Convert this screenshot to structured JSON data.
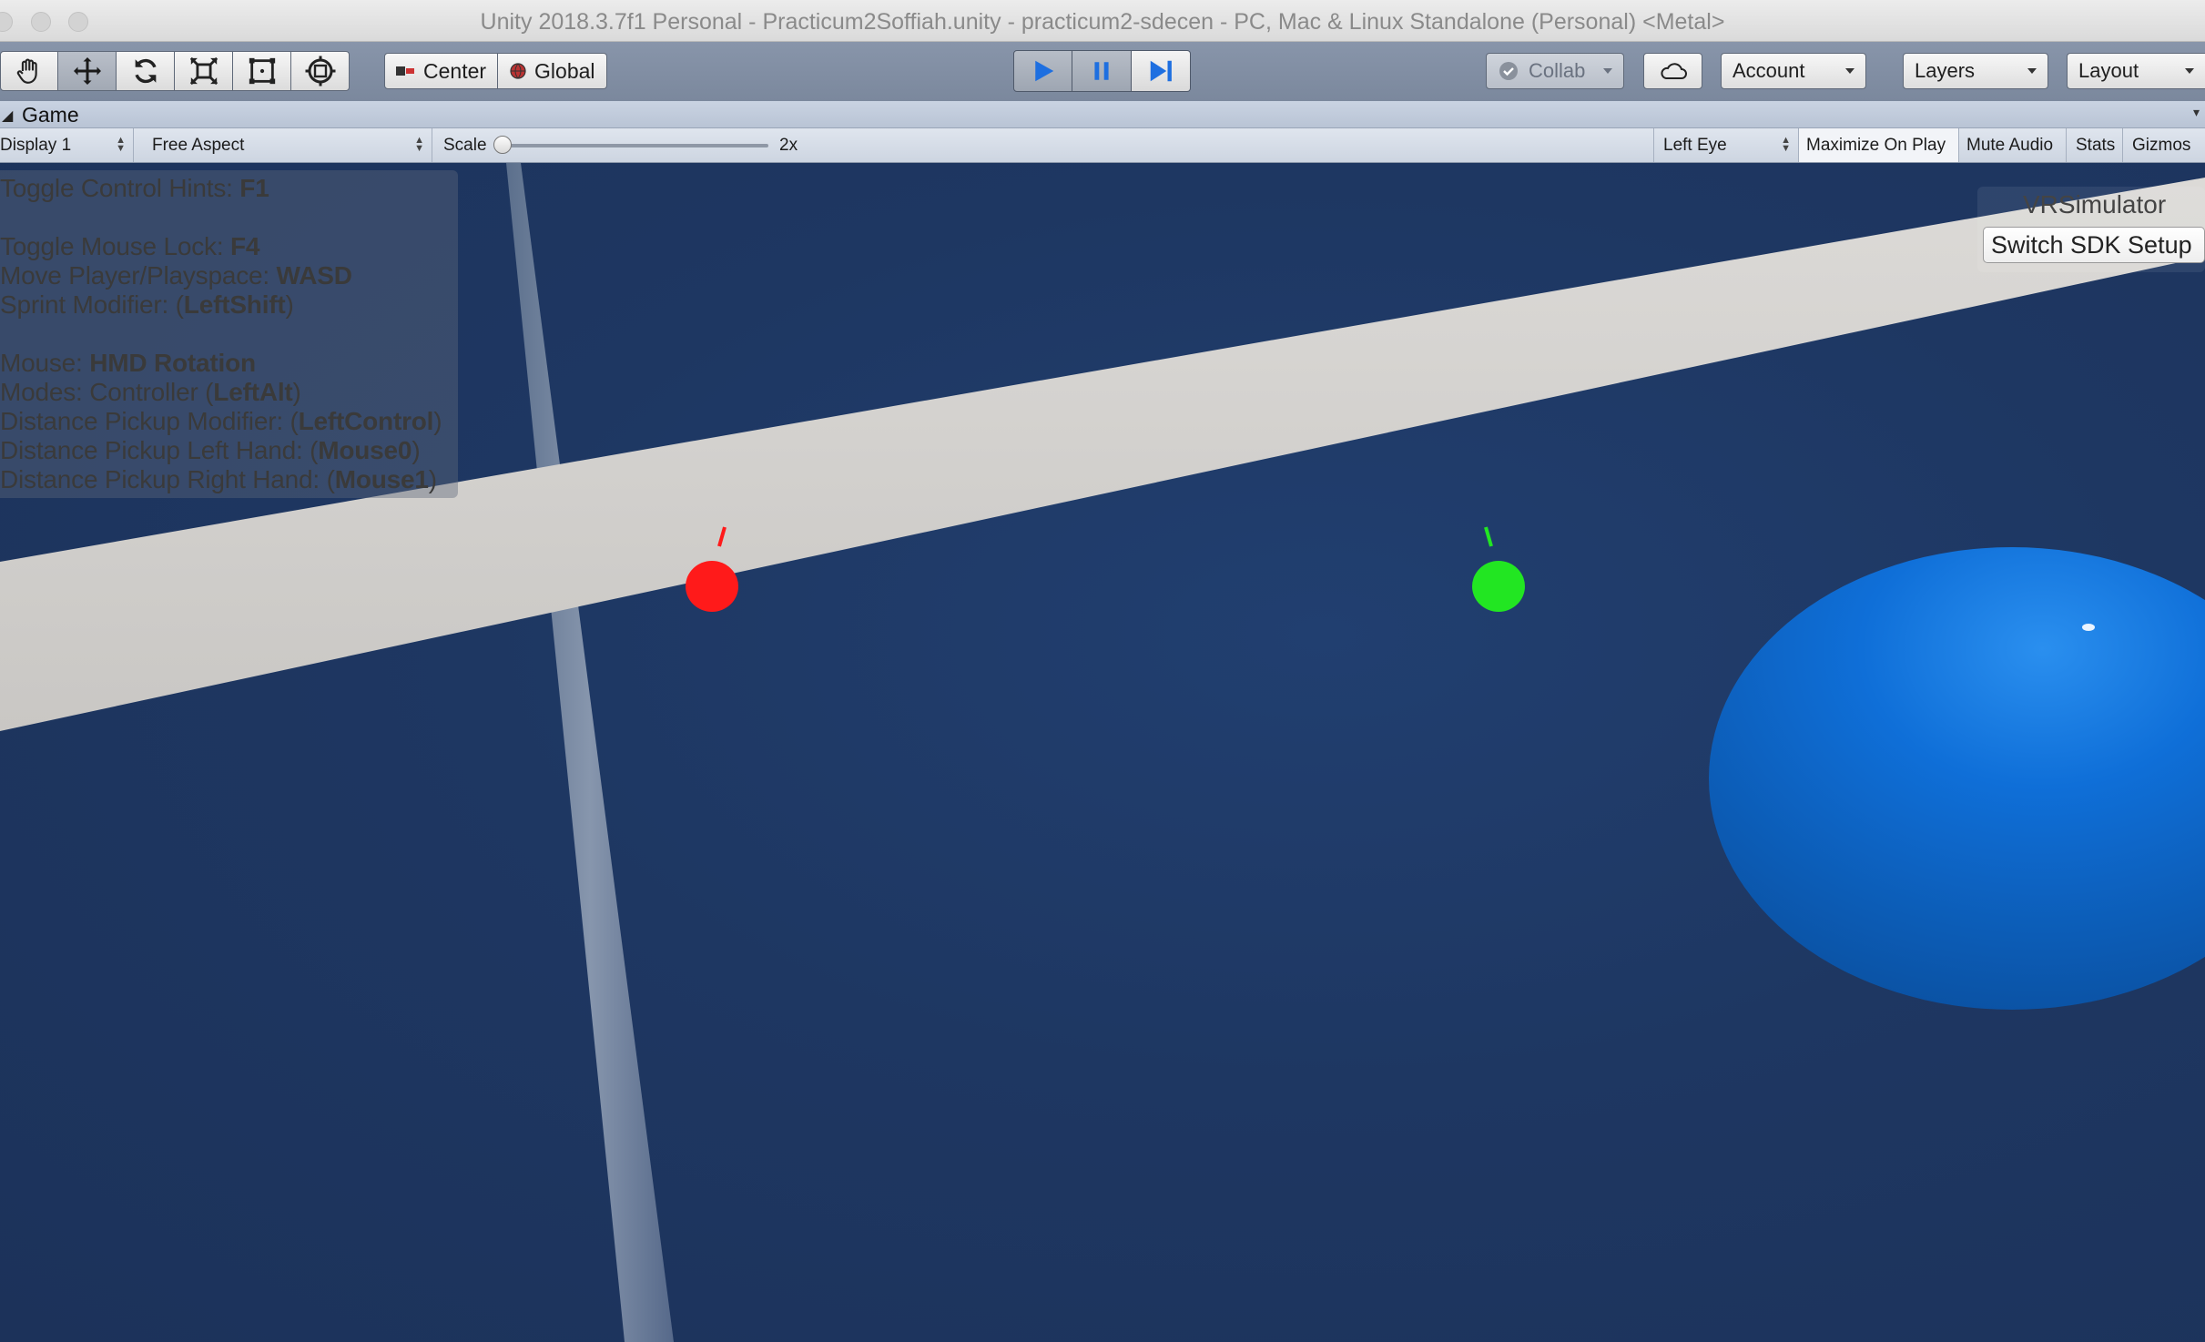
{
  "window": {
    "title": "Unity 2018.3.7f1 Personal - Practicum2Soffiah.unity - practicum2-sdecen - PC, Mac & Linux Standalone (Personal) <Metal>"
  },
  "toolbar": {
    "tools": [
      {
        "name": "hand-tool",
        "icon": "hand-icon"
      },
      {
        "name": "move-tool",
        "icon": "move-arrows-icon",
        "active": true
      },
      {
        "name": "rotate-tool",
        "icon": "rotate-icon"
      },
      {
        "name": "scale-tool",
        "icon": "scale-icon"
      },
      {
        "name": "rect-tool",
        "icon": "rect-icon"
      },
      {
        "name": "transform-tool",
        "icon": "transform-icon"
      }
    ],
    "pivot_label": "Center",
    "space_label": "Global",
    "play_state": "playing",
    "collab_label": "Collab",
    "account_label": "Account",
    "layers_label": "Layers",
    "layout_label": "Layout"
  },
  "tab": {
    "label": "Game"
  },
  "gamebar": {
    "display": "Display 1",
    "aspect": "Free Aspect",
    "scale_label": "Scale",
    "scale_value": "2x",
    "scale_fraction": 0.0,
    "eye": "Left Eye",
    "maximize": "Maximize On Play",
    "mute": "Mute Audio",
    "stats": "Stats",
    "gizmos": "Gizmos"
  },
  "hints": {
    "toggle_hints_prefix": "Toggle Control Hints: ",
    "toggle_hints_key": "F1",
    "mouse_lock_prefix": "Toggle Mouse Lock: ",
    "mouse_lock_key": "F4",
    "move_prefix": "Move Player/Playspace: ",
    "move_key": "WASD",
    "sprint_prefix": "Sprint Modifier: (",
    "sprint_key": "LeftShift",
    "sprint_suffix": ")",
    "mouse_prefix": "Mouse: ",
    "mouse_key": "HMD Rotation",
    "modes_prefix": "Modes: Controller (",
    "modes_key": "LeftAlt",
    "modes_suffix": ")",
    "dist_mod_prefix": "Distance Pickup Modifier: (",
    "dist_mod_key": "LeftControl",
    "dist_mod_suffix": ")",
    "dist_left_prefix": "Distance Pickup Left Hand: (",
    "dist_left_key": "Mouse0",
    "dist_left_suffix": ")",
    "dist_right_prefix": "Distance Pickup Right Hand: (",
    "dist_right_key": "Mouse1",
    "dist_right_suffix": ")"
  },
  "vr": {
    "title": "VRSimulator",
    "switch_button": "Switch SDK Setup"
  },
  "scene": {
    "background_color": "#1c3157",
    "left_controller_color": "#ff1a1a",
    "right_controller_color": "#22e622",
    "sphere_color": "#0e62c6",
    "beam_color": "#d4d2cf"
  }
}
